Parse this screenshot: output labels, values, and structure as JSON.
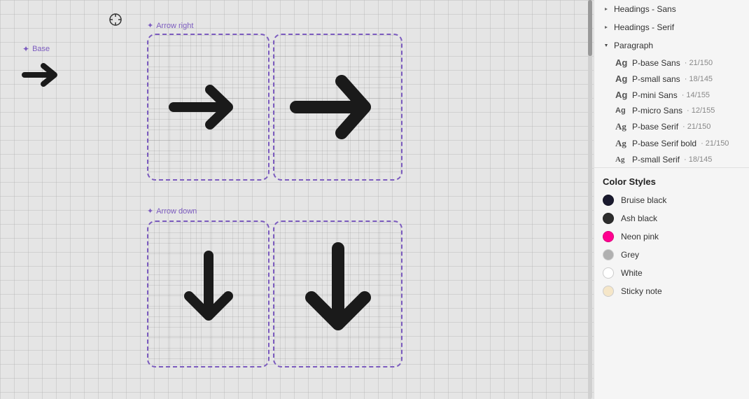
{
  "canvas": {
    "base_label": "Base",
    "arrow_right_label": "Arrow right",
    "arrow_down_label": "Arrow down"
  },
  "panel": {
    "headings_sans": {
      "label": "Headings - Sans",
      "collapsed": true
    },
    "headings_serif": {
      "label": "Headings - Serif",
      "collapsed": true
    },
    "paragraph": {
      "label": "Paragraph",
      "expanded": true
    },
    "type_styles": [
      {
        "ag": "Ag",
        "name": "P-base Sans",
        "meta": "21/150"
      },
      {
        "ag": "Ag",
        "name": "P-small sans",
        "meta": "18/145"
      },
      {
        "ag": "Ag",
        "name": "P-mini Sans",
        "meta": "14/155"
      },
      {
        "ag": "Ag",
        "name": "P-micro Sans",
        "meta": "12/155"
      },
      {
        "ag": "Ag",
        "name": "P-base Serif",
        "meta": "21/150"
      },
      {
        "ag": "Ag",
        "name": "P-base Serif bold",
        "meta": "21/150"
      },
      {
        "ag": "Ag",
        "name": "P-small Serif",
        "meta": "18/145"
      }
    ],
    "color_styles_header": "Color Styles",
    "colors": [
      {
        "name": "Bruise black",
        "hex": "#1a1a2e",
        "border": "none"
      },
      {
        "name": "Ash black",
        "hex": "#2d2d2d",
        "border": "none"
      },
      {
        "name": "Neon pink",
        "hex": "#ff0090",
        "border": "none"
      },
      {
        "name": "Grey",
        "hex": "#b0b0b0",
        "border": "1px solid #ccc"
      },
      {
        "name": "White",
        "hex": "#ffffff",
        "border": "1px solid #ccc"
      },
      {
        "name": "Sticky note",
        "hex": "#f5e6c8",
        "border": "1px solid #ccc"
      }
    ]
  }
}
